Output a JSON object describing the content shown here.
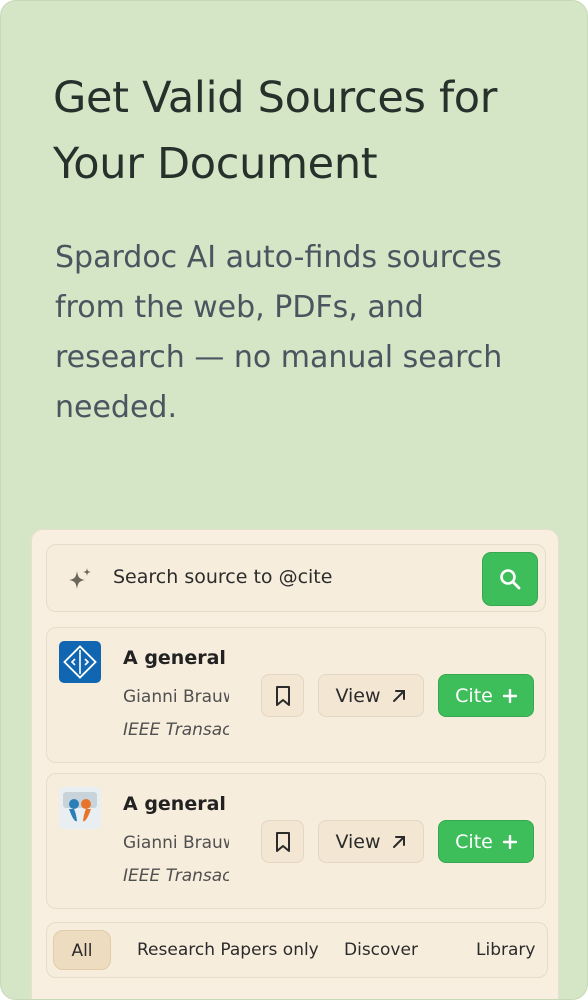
{
  "hero": {
    "headline_line1": "Get Valid Sources for",
    "headline_line2": "Your Document",
    "subtext": "Spardoc AI auto-finds sources from the web, PDFs, and research — no manual search needed."
  },
  "search": {
    "placeholder": "Search source to @cite",
    "icons": {
      "leading": "sparkle-icon",
      "button": "search-icon"
    }
  },
  "results": [
    {
      "logo": "ieee-logo",
      "title": "A general S",
      "authors": "Gianni Brauw",
      "journal": "IEEE Transac",
      "view_label": "View",
      "cite_label": "Cite"
    },
    {
      "logo": "slideshare-logo",
      "title": "A general S",
      "authors": "Gianni Brauw",
      "journal": "IEEE Transac",
      "view_label": "View",
      "cite_label": "Cite"
    }
  ],
  "tabs": [
    {
      "label": "All",
      "active": true
    },
    {
      "label": "Research Papers only",
      "active": false
    },
    {
      "label": "Discover",
      "active": false
    },
    {
      "label": "Library",
      "active": false
    }
  ],
  "colors": {
    "background": "#d5e6c6",
    "panel": "#f8efe1",
    "accent_green": "#3ebd5b",
    "headline": "#26312c",
    "subtext": "#4a5560"
  }
}
